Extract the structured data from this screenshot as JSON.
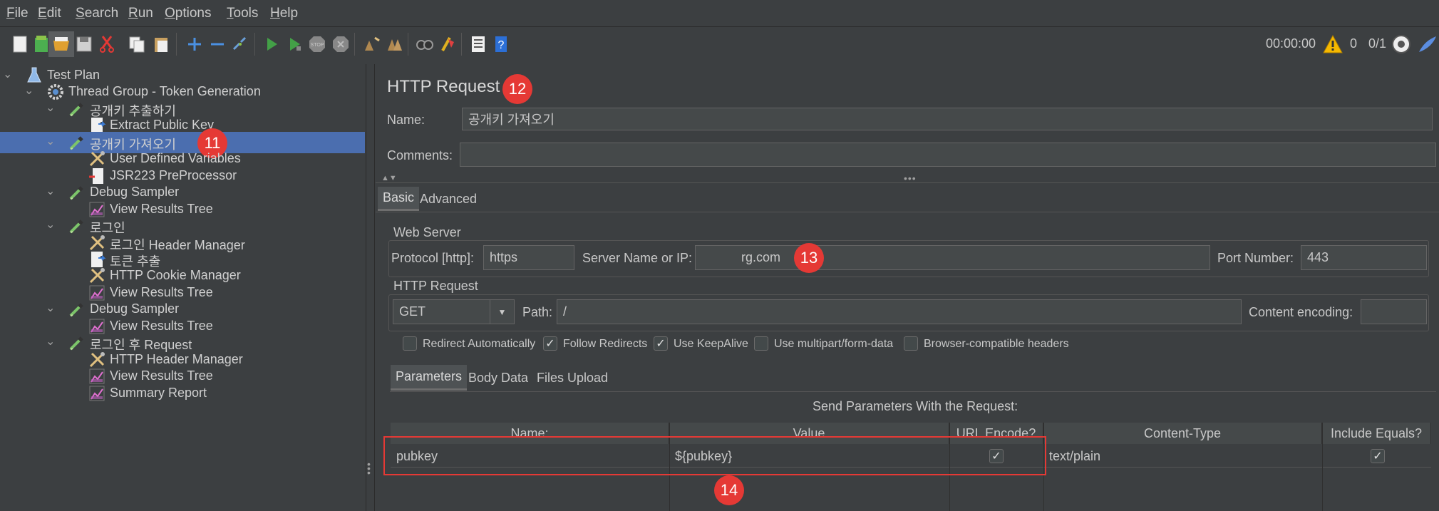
{
  "menubar": {
    "items": [
      {
        "key": "F",
        "rest": "ile"
      },
      {
        "key": "E",
        "rest": "dit"
      },
      {
        "key": "S",
        "rest": "earch"
      },
      {
        "key": "R",
        "rest": "un"
      },
      {
        "key": "O",
        "rest": "ptions"
      },
      {
        "key": "T",
        "rest": "ools"
      },
      {
        "key": "H",
        "rest": "elp"
      }
    ]
  },
  "toolbar": {
    "timer": "00:00:00",
    "warning_count": "0",
    "threads": "0/1",
    "buttons": [
      "new-icon",
      "templates-icon",
      "open-icon",
      "save-icon",
      "cut-icon",
      "copy-icon",
      "paste-icon",
      "expand-icon",
      "collapse-icon",
      "toggle-icon",
      "start-icon",
      "start-no-pauses-icon",
      "stop-icon",
      "shutdown-icon",
      "clear-icon",
      "clear-all-icon",
      "search-icon",
      "reset-search-icon",
      "function-helper-icon",
      "help-icon"
    ]
  },
  "tree": {
    "items": [
      {
        "label": "Test Plan",
        "icon": "flask-icon",
        "level": 0
      },
      {
        "label": "Thread Group - Token Generation",
        "icon": "gear-icon",
        "level": 1
      },
      {
        "label": "공개키 추출하기",
        "icon": "pipette-icon",
        "level": 2
      },
      {
        "label": "Extract Public Key",
        "icon": "extractor-icon",
        "level": 3
      },
      {
        "label": "공개키 가져오기",
        "icon": "pipette-icon",
        "level": 2,
        "selected": true
      },
      {
        "label": "User Defined Variables",
        "icon": "tools-icon",
        "level": 3
      },
      {
        "label": "JSR223 PreProcessor",
        "icon": "preprocessor-icon",
        "level": 3
      },
      {
        "label": "Debug Sampler",
        "icon": "pipette-icon",
        "level": 2
      },
      {
        "label": "View Results Tree",
        "icon": "chart-icon",
        "level": 3
      },
      {
        "label": "로그인",
        "icon": "pipette-icon",
        "level": 2
      },
      {
        "label": "로그인 Header Manager",
        "icon": "tools-icon",
        "level": 3
      },
      {
        "label": "토큰 추출",
        "icon": "extractor-icon",
        "level": 3
      },
      {
        "label": "HTTP Cookie Manager",
        "icon": "tools-icon",
        "level": 3
      },
      {
        "label": "View Results Tree",
        "icon": "chart-icon",
        "level": 3
      },
      {
        "label": "Debug Sampler",
        "icon": "pipette-icon",
        "level": 2
      },
      {
        "label": "View Results Tree",
        "icon": "chart-icon",
        "level": 3
      },
      {
        "label": "로그인 후 Request",
        "icon": "pipette-icon",
        "level": 2
      },
      {
        "label": "HTTP Header Manager",
        "icon": "tools-icon",
        "level": 3
      },
      {
        "label": "View Results Tree",
        "icon": "chart-icon",
        "level": 3
      },
      {
        "label": "Summary Report",
        "icon": "chart-icon",
        "level": 3
      }
    ]
  },
  "panel": {
    "title": "HTTP Request",
    "name_label": "Name:",
    "name_value": "공개키 가져오기",
    "comments_label": "Comments:",
    "comments_value": "",
    "tabs": [
      "Basic",
      "Advanced"
    ],
    "web_server": {
      "title": "Web Server",
      "protocol_label": "Protocol [http]:",
      "protocol_value": "https",
      "server_label": "Server Name or IP:",
      "server_value": "rg.com",
      "port_label": "Port Number:",
      "port_value": "443"
    },
    "http_request": {
      "title": "HTTP Request",
      "method": "GET",
      "path_label": "Path:",
      "path_value": "/",
      "encoding_label": "Content encoding:",
      "encoding_value": ""
    },
    "options": [
      {
        "label": "Redirect Automatically",
        "checked": false
      },
      {
        "label": "Follow Redirects",
        "checked": true
      },
      {
        "label": "Use KeepAlive",
        "checked": true
      },
      {
        "label": "Use multipart/form-data",
        "checked": false
      },
      {
        "label": "Browser-compatible headers",
        "checked": false
      }
    ],
    "param_tabs": [
      "Parameters",
      "Body Data",
      "Files Upload"
    ],
    "params_caption": "Send Parameters With the Request:",
    "columns": [
      "Name:",
      "Value",
      "URL Encode?",
      "Content-Type",
      "Include Equals?"
    ],
    "rows": [
      {
        "name": "pubkey",
        "value": "${pubkey}",
        "url_encode": true,
        "content_type": "text/plain",
        "include_equals": true
      }
    ]
  },
  "callouts": {
    "c11": "11",
    "c12": "12",
    "c13": "13",
    "c14": "14"
  },
  "colors": {
    "selection": "#4b6eaf",
    "callout": "#e53935",
    "background": "#3c3f41"
  }
}
